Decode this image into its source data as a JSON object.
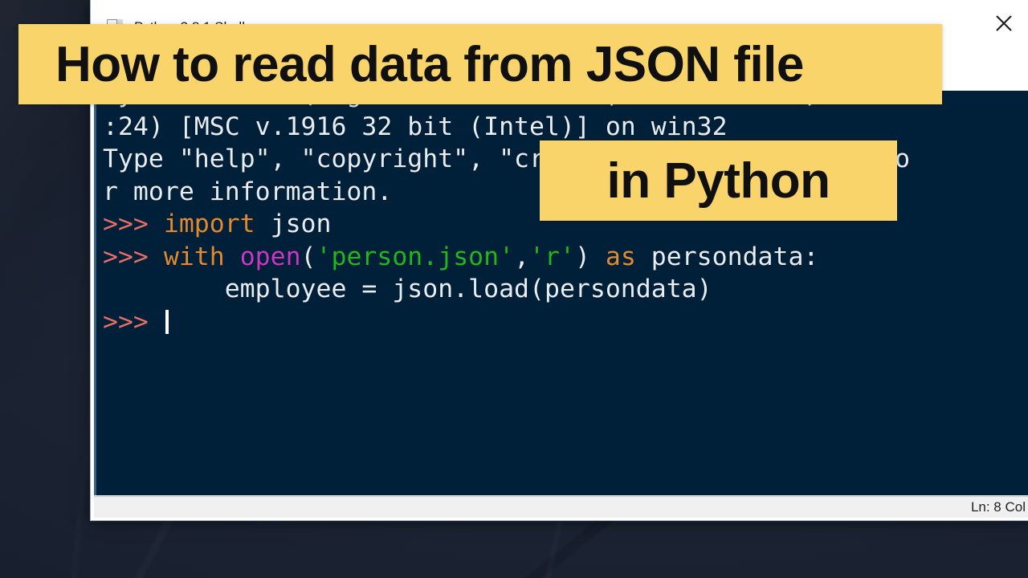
{
  "window": {
    "title": "Python 3.8.1 Shell",
    "icon": "python-file-icon",
    "close_label": "×"
  },
  "overlay": {
    "banner_line1": "How to read data from JSON file",
    "banner_line2": "in Python",
    "banner_color": "#f9d46a",
    "text_color": "#101010"
  },
  "shell": {
    "background": "#002039",
    "foreground": "#e8edf2",
    "prompt": ">>>",
    "lines": [
      {
        "id": "banner-version",
        "segments": [
          {
            "cls": "c-plain",
            "text": "Python 3.8.1 (tags/v3.8.1:1b293b6, Dec 18 2019, 22:39"
          }
        ]
      },
      {
        "id": "banner-msc",
        "segments": [
          {
            "cls": "c-plain",
            "text": ":24) [MSC v.1916 32 bit (Intel)] on win32"
          }
        ]
      },
      {
        "id": "banner-help",
        "segments": [
          {
            "cls": "c-plain",
            "text": "Type \"help\", \"copyright\", \"credits\" or \"license()\" fo"
          }
        ]
      },
      {
        "id": "banner-more",
        "segments": [
          {
            "cls": "c-plain",
            "text": "r more information."
          }
        ]
      },
      {
        "id": "stmt-import",
        "segments": [
          {
            "cls": "c-prompt",
            "text": ">>> "
          },
          {
            "cls": "c-kw",
            "text": "import"
          },
          {
            "cls": "c-plain",
            "text": " json"
          }
        ]
      },
      {
        "id": "stmt-with-open",
        "segments": [
          {
            "cls": "c-prompt",
            "text": ">>> "
          },
          {
            "cls": "c-kw",
            "text": "with"
          },
          {
            "cls": "c-plain",
            "text": " "
          },
          {
            "cls": "c-builtin",
            "text": "open"
          },
          {
            "cls": "c-plain",
            "text": "("
          },
          {
            "cls": "c-str",
            "text": "'person.json'"
          },
          {
            "cls": "c-plain",
            "text": ","
          },
          {
            "cls": "c-str",
            "text": "'r'"
          },
          {
            "cls": "c-plain",
            "text": ") "
          },
          {
            "cls": "c-kw",
            "text": "as"
          },
          {
            "cls": "c-plain",
            "text": " persondata:"
          }
        ]
      },
      {
        "id": "stmt-load",
        "segments": [
          {
            "cls": "c-plain",
            "text": "        employee = json.load(persondata)"
          }
        ]
      },
      {
        "id": "blank-1",
        "segments": [
          {
            "cls": "c-plain",
            "text": ""
          }
        ]
      },
      {
        "id": "blank-2",
        "segments": [
          {
            "cls": "c-plain",
            "text": ""
          }
        ]
      },
      {
        "id": "prompt-active",
        "segments": [
          {
            "cls": "c-prompt",
            "text": ">>> "
          }
        ],
        "caret": true
      }
    ]
  },
  "statusbar": {
    "position_text": "Ln: 8  Col"
  }
}
